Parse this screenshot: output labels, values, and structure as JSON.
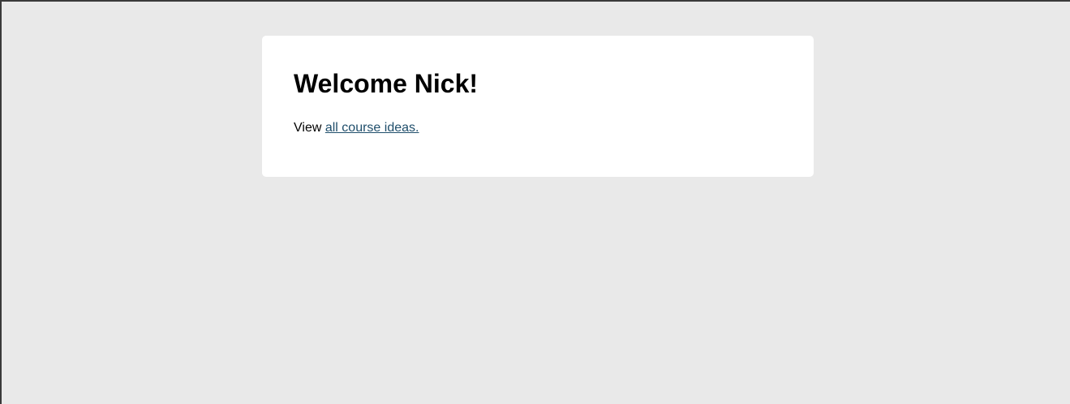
{
  "greeting": {
    "title": "Welcome Nick!",
    "view_prefix": "View",
    "link_label": "all course ideas."
  },
  "colors": {
    "background": "#e9e9e9",
    "card": "#ffffff",
    "link": "#1f4e6b"
  }
}
